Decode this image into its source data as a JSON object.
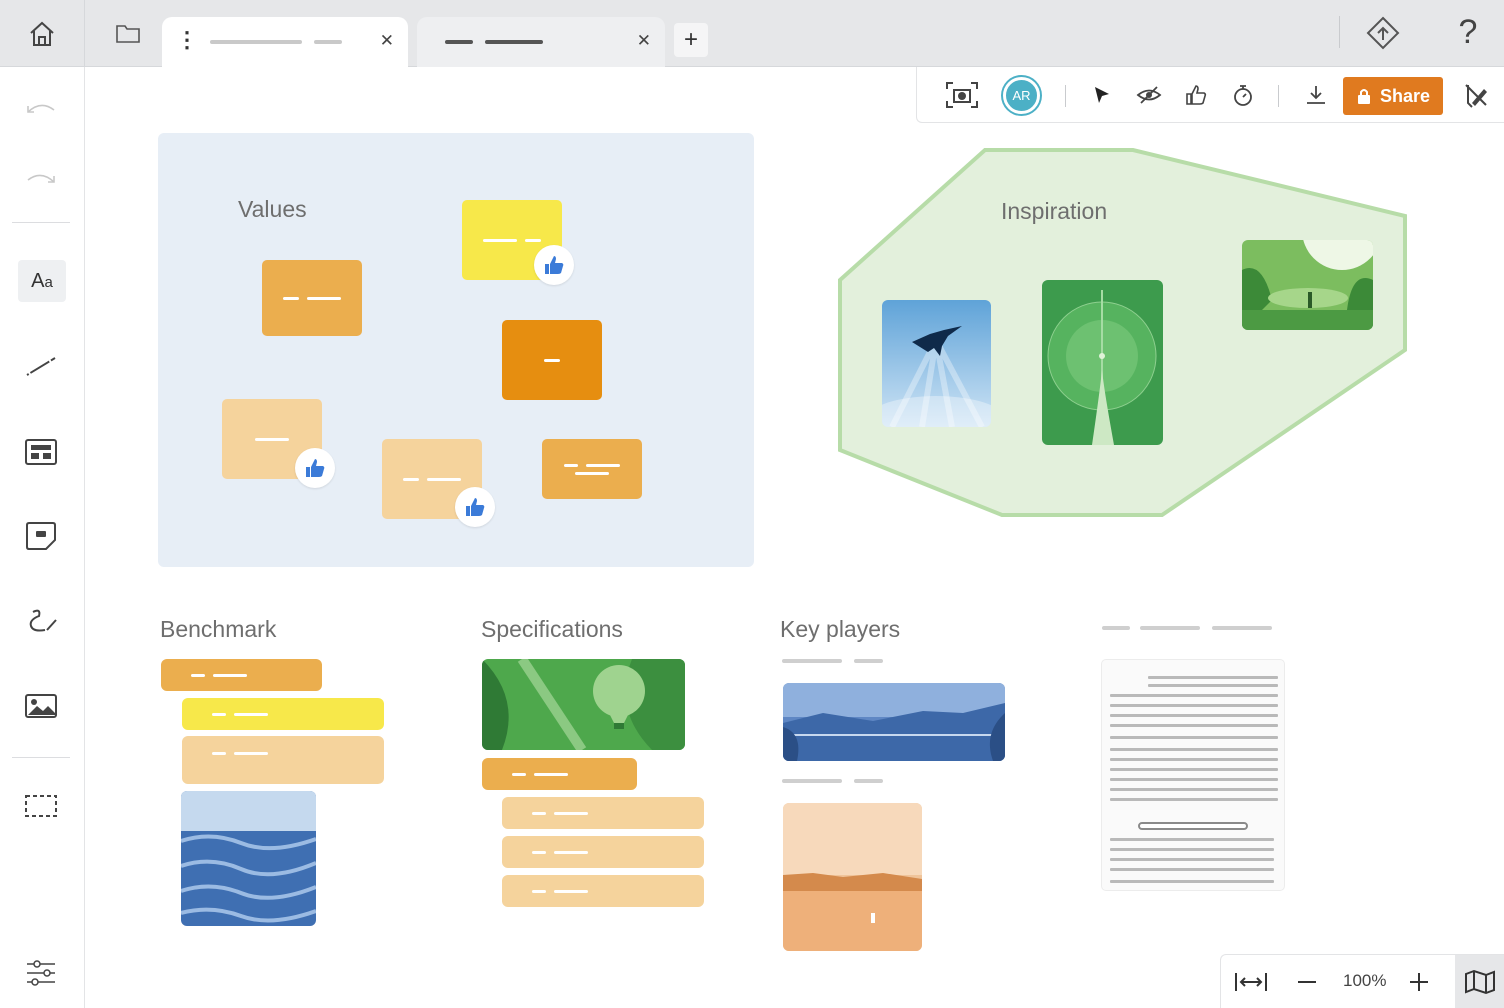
{
  "tabs": [
    {
      "label": "",
      "active": true
    },
    {
      "label": "",
      "active": false
    }
  ],
  "toolbar": {
    "avatar_initials": "AR",
    "share_label": "Share"
  },
  "canvas": {
    "values_title": "Values",
    "inspiration_title": "Inspiration",
    "benchmark_title": "Benchmark",
    "specifications_title": "Specifications",
    "key_players_title": "Key players"
  },
  "zoom": {
    "level": "100%"
  },
  "icons": {
    "home": "home-icon",
    "folder": "folder-icon",
    "diamond": "version-history-icon",
    "help": "help-icon",
    "undo": "undo-icon",
    "redo": "redo-icon",
    "text": "text-tool-icon",
    "line": "line-tool-icon",
    "template": "template-icon",
    "sticky": "sticky-note-icon",
    "pen": "pen-tool-icon",
    "image": "image-icon",
    "frame": "frame-tool-icon",
    "settings": "settings-sliders-icon",
    "screenshot": "screenshot-icon",
    "pointer": "pointer-icon",
    "eye": "hide-eye-icon",
    "thumbs": "vote-thumbs-up-icon",
    "timer": "timer-icon",
    "download": "download-icon",
    "lock": "lock-icon",
    "pencil-off": "edit-off-icon",
    "fit": "fit-width-icon",
    "minus": "zoom-out-icon",
    "plus": "zoom-in-icon",
    "map": "map-icon"
  },
  "colors": {
    "accent": "#e07a1f",
    "frame_blue": "#e7eef6",
    "frame_green": "#e3f0dc",
    "note_orange": "#ebae4e",
    "note_dark_orange": "#e68e10",
    "note_yellow": "#f7e84a",
    "note_light": "#f5d39c",
    "avatar": "#4cb0c6"
  }
}
